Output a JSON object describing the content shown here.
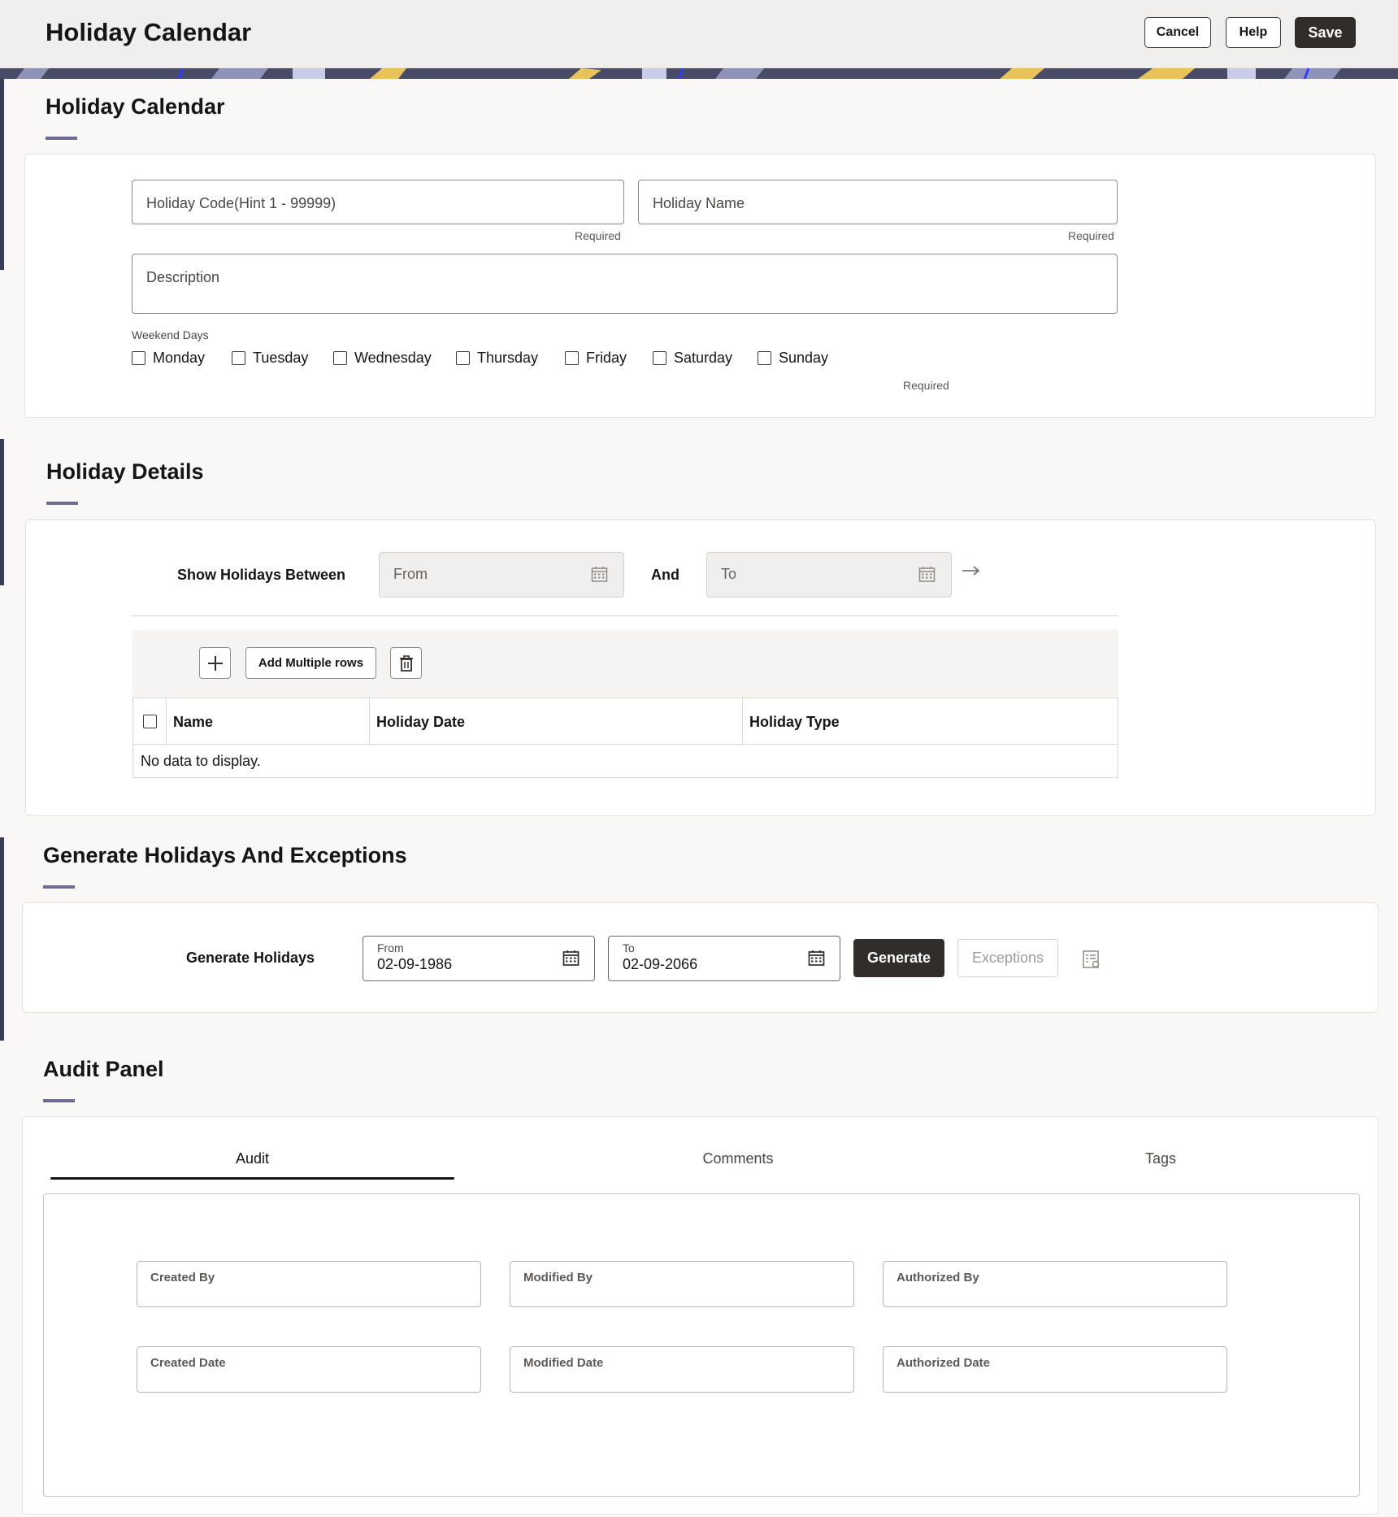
{
  "header": {
    "title": "Holiday Calendar",
    "cancel_label": "Cancel",
    "help_label": "Help",
    "save_label": "Save"
  },
  "holiday_calendar": {
    "title": "Holiday Calendar",
    "holiday_code_placeholder": "Holiday Code(Hint 1 - 99999)",
    "holiday_name_placeholder": "Holiday Name",
    "required_label": "Required",
    "description_placeholder": "Description",
    "weekend_days_label": "Weekend Days",
    "weekend_days": [
      "Monday",
      "Tuesday",
      "Wednesday",
      "Thursday",
      "Friday",
      "Saturday",
      "Sunday"
    ]
  },
  "holiday_details": {
    "title": "Holiday Details",
    "show_between_label": "Show Holidays Between",
    "from_placeholder": "From",
    "and_label": "And",
    "to_placeholder": "To",
    "add_multiple_label": "Add Multiple rows",
    "columns": [
      "Name",
      "Holiday Date",
      "Holiday Type"
    ],
    "empty_text": "No data to display."
  },
  "generate": {
    "title": "Generate Holidays And Exceptions",
    "label": "Generate Holidays",
    "from_label": "From",
    "from_value": "02-09-1986",
    "to_label": "To",
    "to_value": "02-09-2066",
    "generate_label": "Generate",
    "exceptions_label": "Exceptions"
  },
  "audit": {
    "title": "Audit Panel",
    "tabs": [
      "Audit",
      "Comments",
      "Tags"
    ],
    "active_tab": "Audit",
    "fields": [
      "Created By",
      "Modified By",
      "Authorized By",
      "Created Date",
      "Modified Date",
      "Authorized Date"
    ]
  }
}
